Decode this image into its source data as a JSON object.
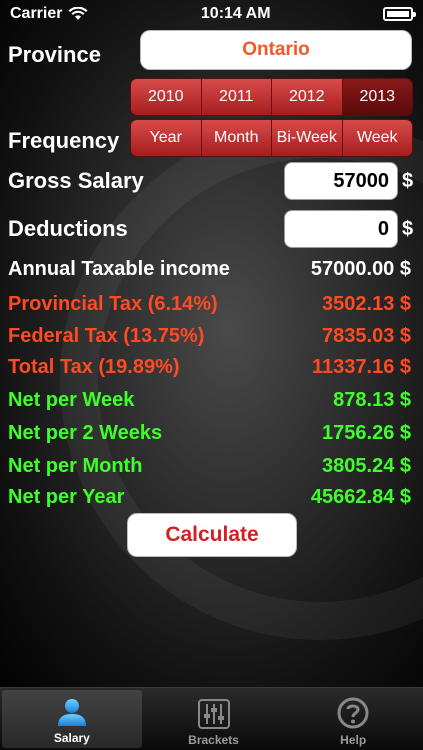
{
  "status": {
    "carrier": "Carrier",
    "time": "10:14 AM"
  },
  "province": {
    "label": "Province",
    "value": "Ontario"
  },
  "years": [
    {
      "label": "2010",
      "selected": false
    },
    {
      "label": "2011",
      "selected": false
    },
    {
      "label": "2012",
      "selected": false
    },
    {
      "label": "2013",
      "selected": true
    }
  ],
  "frequency": {
    "label": "Frequency",
    "options": [
      {
        "label": "Year",
        "selected": false
      },
      {
        "label": "Month",
        "selected": false
      },
      {
        "label": "Bi-Week",
        "selected": false
      },
      {
        "label": "Week",
        "selected": false
      }
    ]
  },
  "gross_salary": {
    "label": "Gross Salary",
    "value": "57000",
    "unit": "$"
  },
  "deductions": {
    "label": "Deductions",
    "value": "0",
    "unit": "$"
  },
  "results": {
    "annual_taxable": {
      "label": "Annual Taxable income",
      "value": "57000.00 $"
    },
    "provincial_tax": {
      "label": "Provincial Tax (6.14%)",
      "value": "3502.13 $"
    },
    "federal_tax": {
      "label": "Federal Tax (13.75%)",
      "value": "7835.03 $"
    },
    "total_tax": {
      "label": "Total Tax (19.89%)",
      "value": "11337.16 $"
    },
    "net_week": {
      "label": "Net per Week",
      "value": "878.13 $"
    },
    "net_2weeks": {
      "label": "Net per 2 Weeks",
      "value": "1756.26 $"
    },
    "net_month": {
      "label": "Net per Month",
      "value": "3805.24 $"
    },
    "net_year": {
      "label": "Net per Year",
      "value": "45662.84 $"
    }
  },
  "calculate_label": "Calculate",
  "tabs": [
    {
      "label": "Salary",
      "icon": "person-icon",
      "active": true
    },
    {
      "label": "Brackets",
      "icon": "sliders-icon",
      "active": false
    },
    {
      "label": "Help",
      "icon": "question-icon",
      "active": false
    }
  ],
  "colors": {
    "tax": "#ff4a22",
    "net": "#3dff2a",
    "accent": "#f05a2a",
    "segment": "#c03030"
  }
}
